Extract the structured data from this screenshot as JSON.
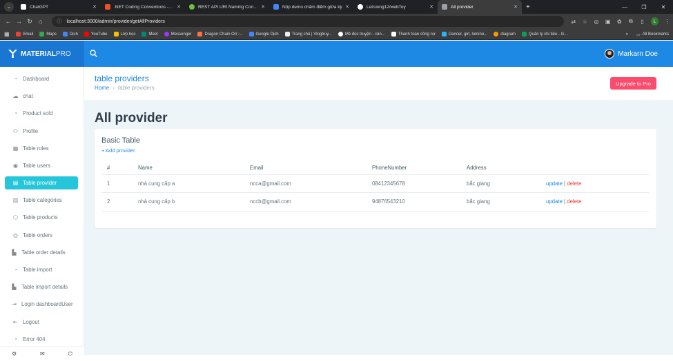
{
  "browser": {
    "tabs": [
      {
        "label": "ChatGPT",
        "color": "#ffffff"
      },
      {
        "label": ".NET Coding Conventions - C#",
        "color": "#f25022"
      },
      {
        "label": "REST API URI Naming Conventi",
        "color": "#6fbf40"
      },
      {
        "label": "Nộp demo chấm điểm giữa kỳ",
        "color": "#4285f4"
      },
      {
        "label": "Letruong12/webToy",
        "color": "#ffffff"
      },
      {
        "label": "All provider",
        "color": "#9aa0a6"
      }
    ],
    "url": "localhost:3000/admin/provider/getAllProviders",
    "profile_initial": "L",
    "bookmarks": [
      {
        "label": "Gmail",
        "color": "#ea4335"
      },
      {
        "label": "Maps",
        "color": "#34a853"
      },
      {
        "label": "Dịch",
        "color": "#4285f4"
      },
      {
        "label": "YouTube",
        "color": "#ff0000"
      },
      {
        "label": "Lớp học",
        "color": "#fbbc05"
      },
      {
        "label": "Meet",
        "color": "#00897b"
      },
      {
        "label": "Messenger",
        "color": "#a033ff"
      },
      {
        "label": "Dragon Chain Ori :...",
        "color": "#ff7043"
      },
      {
        "label": "Google Dịch",
        "color": "#4285f4"
      },
      {
        "label": "Trang chủ | Vlogtruy...",
        "color": "#eeeeee"
      },
      {
        "label": "Mê đọc truyện - cản...",
        "color": "#ffffff"
      },
      {
        "label": "Thanh toán công nợ",
        "color": "#ffffff"
      },
      {
        "label": "Dancer, girl, lumino...",
        "color": "#29b6f6"
      },
      {
        "label": "diagram",
        "color": "#ff9800"
      },
      {
        "label": "Quản lý chi tiêu - G...",
        "color": "#0f9d58"
      }
    ],
    "all_bookmarks": "All Bookmarks"
  },
  "header": {
    "brand": "MATERIAL",
    "brand_suffix": "PRO",
    "user_name": "Markarn Doe"
  },
  "sidebar": {
    "items": [
      {
        "label": "Dashboard",
        "icon": "◔"
      },
      {
        "label": "chat",
        "icon": "☁"
      },
      {
        "label": "Product sold",
        "icon": "◔"
      },
      {
        "label": "Profile",
        "icon": "⚇"
      },
      {
        "label": "Table roles",
        "icon": "▦"
      },
      {
        "label": "Table users",
        "icon": "◉"
      },
      {
        "label": "Table provider",
        "icon": "▤"
      },
      {
        "label": "Table categories",
        "icon": "▥"
      },
      {
        "label": "Table products",
        "icon": "⬡"
      },
      {
        "label": "Table orders",
        "icon": "◎"
      },
      {
        "label": "Table order details",
        "icon": "▙"
      },
      {
        "label": "Table import",
        "icon": "◔"
      },
      {
        "label": "Table import details",
        "icon": "▙"
      },
      {
        "label": "Login dashboardUser",
        "icon": "⇥"
      },
      {
        "label": "Logout",
        "icon": "⇤"
      },
      {
        "label": "Error 404",
        "icon": "◔"
      }
    ],
    "active_index": 6
  },
  "page": {
    "title": "table providers",
    "breadcrumb_home": "Home",
    "breadcrumb_current": "table providers",
    "upgrade_label": "Upgrade to Pro",
    "heading": "All provider"
  },
  "card": {
    "title": "Basic Table",
    "add_label": "+ Add provider",
    "columns": [
      "#",
      "Name",
      "Email",
      "PhoneNumber",
      "Address",
      ""
    ],
    "rows": [
      {
        "id": "1",
        "name": "nhà cung cấp a",
        "email": "ncca@gmail.com",
        "phone": "08412345678",
        "address": "bắc giang",
        "update": "update",
        "sep": "|",
        "delete": "delete"
      },
      {
        "id": "2",
        "name": "nhà cung cấp b",
        "email": "nccb@gmail.com",
        "phone": "94876543210",
        "address": "bắc giang",
        "update": "update",
        "sep": "|",
        "delete": "delete"
      }
    ]
  }
}
